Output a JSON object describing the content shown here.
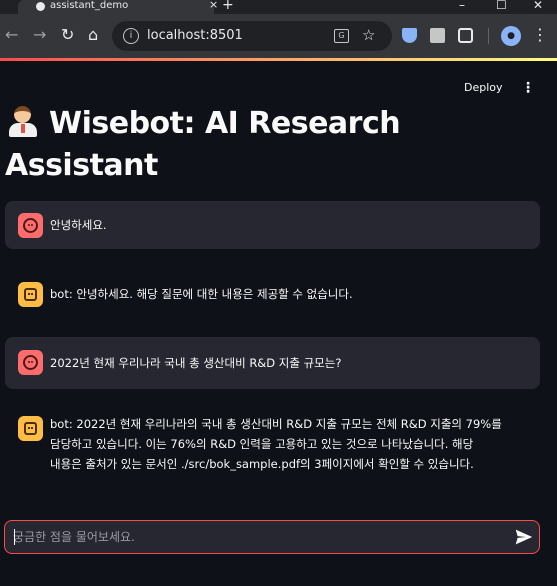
{
  "browser": {
    "tab_title": "assistant_demo",
    "tab_close": "×",
    "new_tab": "+",
    "url": "localhost:8501",
    "window_controls": [
      "–",
      "☐",
      "✕"
    ],
    "icons": [
      "back-icon",
      "forward-icon",
      "reload-icon",
      "home-icon",
      "site-info-icon",
      "translate-icon",
      "bookmark-star-icon",
      "extension-icons",
      "profile-avatar",
      "browser-menu-icon"
    ]
  },
  "app": {
    "deploy_label": "Deploy",
    "menu_glyph": "⋮",
    "title": "Wisebot: AI Research Assistant",
    "title_icon": "scientist-emoji",
    "accent_color": "#ff4b4b"
  },
  "messages": [
    {
      "role": "user",
      "avatar": "user-face-icon",
      "text": "안녕하세요."
    },
    {
      "role": "bot",
      "avatar": "bot-robot-icon",
      "text": "bot: 안녕하세요. 해당 질문에 대한 내용은 제공할 수 없습니다."
    },
    {
      "role": "user",
      "avatar": "user-face-icon",
      "text": "2022년 현재 우리나라 국내 총 생산대비 R&D 지출 규모는?"
    },
    {
      "role": "bot",
      "avatar": "bot-robot-icon",
      "lines": [
        "bot: 2022년 현재 우리나라의 국내 총 생산대비 R&D 지출 규모는 전체 R&D 지출의 79%를",
        "담당하고 있습니다. 이는 76%의 R&D 인력을 고용하고 있는 것으로 나타났습니다. 해당",
        "내용은 출처가 있는 문서인 ./src/bok_sample.pdf의 3페이지에서 확인할 수 있습니다."
      ]
    }
  ],
  "chat_input": {
    "placeholder": "궁금한 점을 물어보세요.",
    "value": ""
  }
}
